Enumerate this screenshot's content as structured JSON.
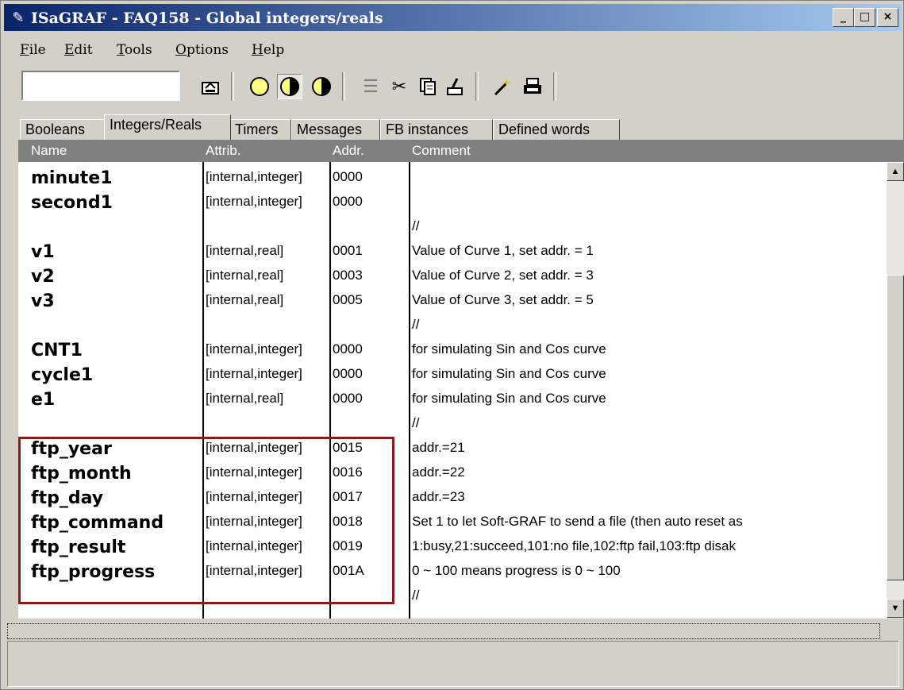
{
  "window": {
    "title": "ISaGRAF - FAQ158 - Global integers/reals",
    "controls": {
      "minimize": "_",
      "maximize": "□",
      "close": "×"
    }
  },
  "menu": [
    {
      "label": "File",
      "u": "F",
      "rest": "ile"
    },
    {
      "label": "Edit",
      "u": "E",
      "rest": "dit"
    },
    {
      "label": "Tools",
      "u": "T",
      "rest": "ools"
    },
    {
      "label": "Options",
      "u": "O",
      "rest": "ptions"
    },
    {
      "label": "Help",
      "u": "H",
      "rest": "elp"
    }
  ],
  "toolbar": {
    "combo_value": "",
    "icons": [
      "open-icon",
      "circle-empty-icon",
      "circle-half-icon",
      "circle-quarter-icon",
      "list-icon",
      "cut-icon",
      "copy-icon",
      "paste-icon",
      "wand-icon",
      "print-icon"
    ]
  },
  "tabs": [
    "Booleans",
    "Integers/Reals",
    "Timers",
    "Messages",
    "FB instances",
    "Defined words"
  ],
  "active_tab": "Integers/Reals",
  "columns": {
    "name": "Name",
    "attrib": "Attrib.",
    "addr": "Addr.",
    "comment": "Comment"
  },
  "rows": [
    {
      "name": "minute1",
      "attrib": "[internal,integer]",
      "addr": "0000",
      "comment": ""
    },
    {
      "name": "second1",
      "attrib": "[internal,integer]",
      "addr": "0000",
      "comment": ""
    },
    {
      "name": "",
      "attrib": "",
      "addr": "",
      "comment": "//"
    },
    {
      "name": "v1",
      "attrib": "[internal,real]",
      "addr": "0001",
      "comment": "Value of Curve 1, set addr. = 1"
    },
    {
      "name": "v2",
      "attrib": "[internal,real]",
      "addr": "0003",
      "comment": "Value of Curve 2, set addr. = 3"
    },
    {
      "name": "v3",
      "attrib": "[internal,real]",
      "addr": "0005",
      "comment": "Value of Curve 3, set addr. = 5"
    },
    {
      "name": "",
      "attrib": "",
      "addr": "",
      "comment": "//"
    },
    {
      "name": "CNT1",
      "attrib": "[internal,integer]",
      "addr": "0000",
      "comment": "for simulating Sin and Cos curve"
    },
    {
      "name": "cycle1",
      "attrib": "[internal,integer]",
      "addr": "0000",
      "comment": "for simulating Sin and Cos curve"
    },
    {
      "name": "e1",
      "attrib": "[internal,real]",
      "addr": "0000",
      "comment": "for simulating Sin and Cos curve"
    },
    {
      "name": "",
      "attrib": "",
      "addr": "",
      "comment": "//"
    },
    {
      "name": "ftp_year",
      "attrib": "[internal,integer]",
      "addr": "0015",
      "comment": "addr.=21"
    },
    {
      "name": "ftp_month",
      "attrib": "[internal,integer]",
      "addr": "0016",
      "comment": "addr.=22"
    },
    {
      "name": "ftp_day",
      "attrib": "[internal,integer]",
      "addr": "0017",
      "comment": "addr.=23"
    },
    {
      "name": "ftp_command",
      "attrib": "[internal,integer]",
      "addr": "0018",
      "comment": "Set 1 to let Soft-GRAF to send a file (then auto reset as"
    },
    {
      "name": "ftp_result",
      "attrib": "[internal,integer]",
      "addr": "0019",
      "comment": "1:busy,21:succeed,101:no file,102:ftp fail,103:ftp disak"
    },
    {
      "name": "ftp_progress",
      "attrib": "[internal,integer]",
      "addr": "001A",
      "comment": "0  ~  100   means  progress is   0   ~  100"
    },
    {
      "name": "",
      "attrib": "",
      "addr": "",
      "comment": "//"
    }
  ],
  "colors": {
    "highlight_border": "#8b1a1a",
    "title_start": "#0a246a",
    "title_end": "#a6caf0"
  }
}
